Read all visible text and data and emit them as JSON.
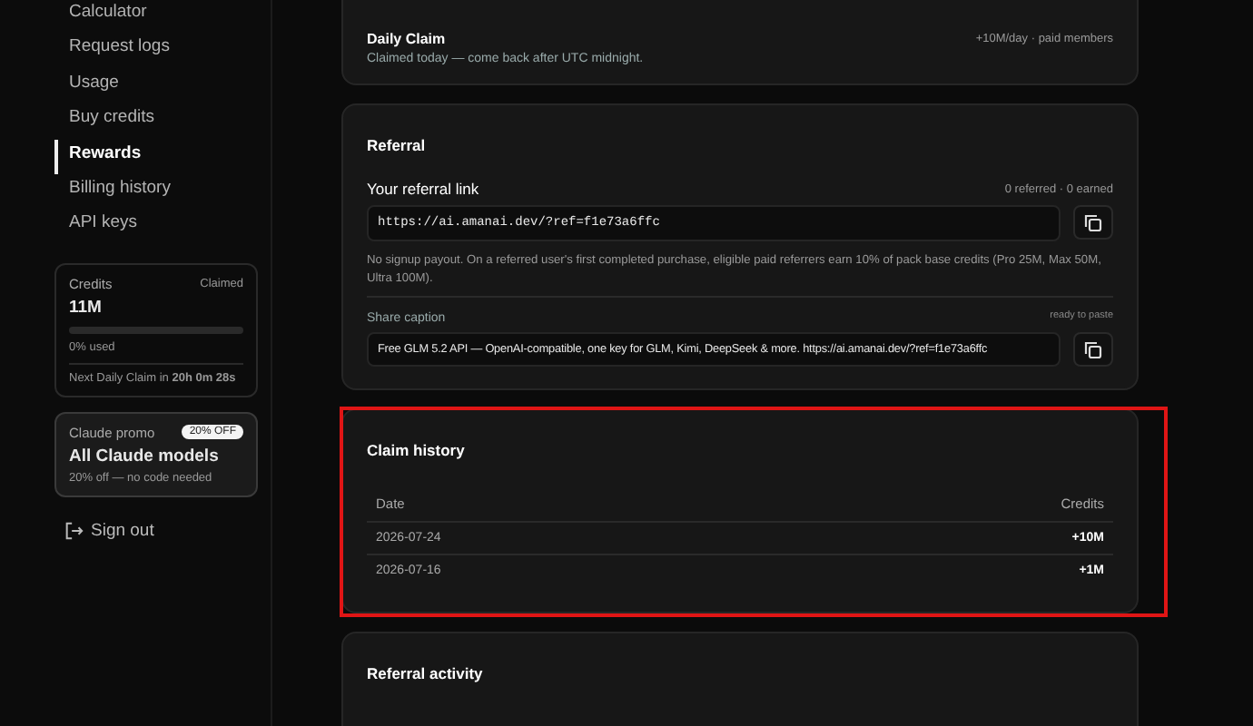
{
  "sidebar": {
    "items": [
      {
        "label": "Calculator",
        "selected": false
      },
      {
        "label": "Request logs",
        "selected": false
      },
      {
        "label": "Usage",
        "selected": false
      },
      {
        "label": "Buy credits",
        "selected": false
      },
      {
        "label": "Rewards",
        "selected": true
      },
      {
        "label": "Billing history",
        "selected": false
      },
      {
        "label": "API keys",
        "selected": false
      }
    ],
    "credits": {
      "label": "Credits",
      "status": "Claimed",
      "amount": "11M",
      "level": 0,
      "used": "0% used",
      "next_claim": "Next Daily Claim in **20h 0m 28s**"
    },
    "promo": {
      "label": "Claude promo",
      "badge": "20% OFF",
      "title": "All Claude models",
      "note": "20% off — no code needed"
    },
    "sign_out": "Sign out"
  },
  "daily_claim": {
    "title": "Daily Claim",
    "note": "+10M/day · paid members",
    "status": "Claimed today — come back after UTC midnight."
  },
  "referral": {
    "title": "Referral",
    "link_label": "Your referral link",
    "stats": "0 referred · 0 earned",
    "link": "https://ai.amanai.dev/?ref=f1e73a6ffc",
    "info": "No signup payout. On a referred user's first completed purchase, eligible paid referrers earn 10% of pack base credits (Pro 25M, Max 50M, Ultra 100M).",
    "caption_label": "Share caption",
    "caption_status": "ready to paste",
    "caption": "Free GLM 5.2 API — OpenAI-compatible, one key for GLM, Kimi, DeepSeek & more. https://ai.amanai.dev/?ref=f1e73a6ffc"
  },
  "claim_history": {
    "title": "Claim history",
    "highlighted": true,
    "columns": [
      "Date",
      "Credits"
    ],
    "rows": [
      {
        "date": "2026-07-24",
        "credits": "+10M"
      },
      {
        "date": "2026-07-16",
        "credits": "+1M"
      }
    ]
  },
  "referral_activity": {
    "title": "Referral activity"
  }
}
